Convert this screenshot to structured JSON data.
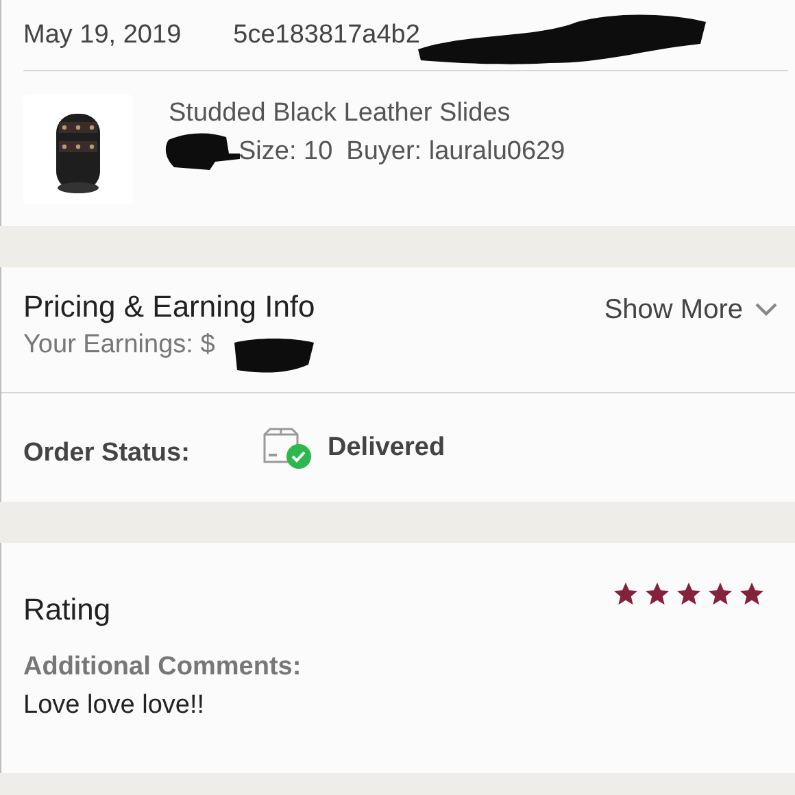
{
  "order": {
    "date": "May 19, 2019",
    "order_id": "5ce183817a4b2"
  },
  "item": {
    "title": "Studded Black Leather Slides",
    "size": "Size: 10",
    "buyer": "Buyer: lauralu0629"
  },
  "pricing": {
    "title": "Pricing & Earning Info",
    "earnings": "Your Earnings: $",
    "toggle": "Show More"
  },
  "status": {
    "label": "Order Status:",
    "value": "Delivered"
  },
  "rating": {
    "title": "Rating",
    "stars": 5,
    "comments_label": "Additional Comments:",
    "comments": "Love love love!!"
  }
}
